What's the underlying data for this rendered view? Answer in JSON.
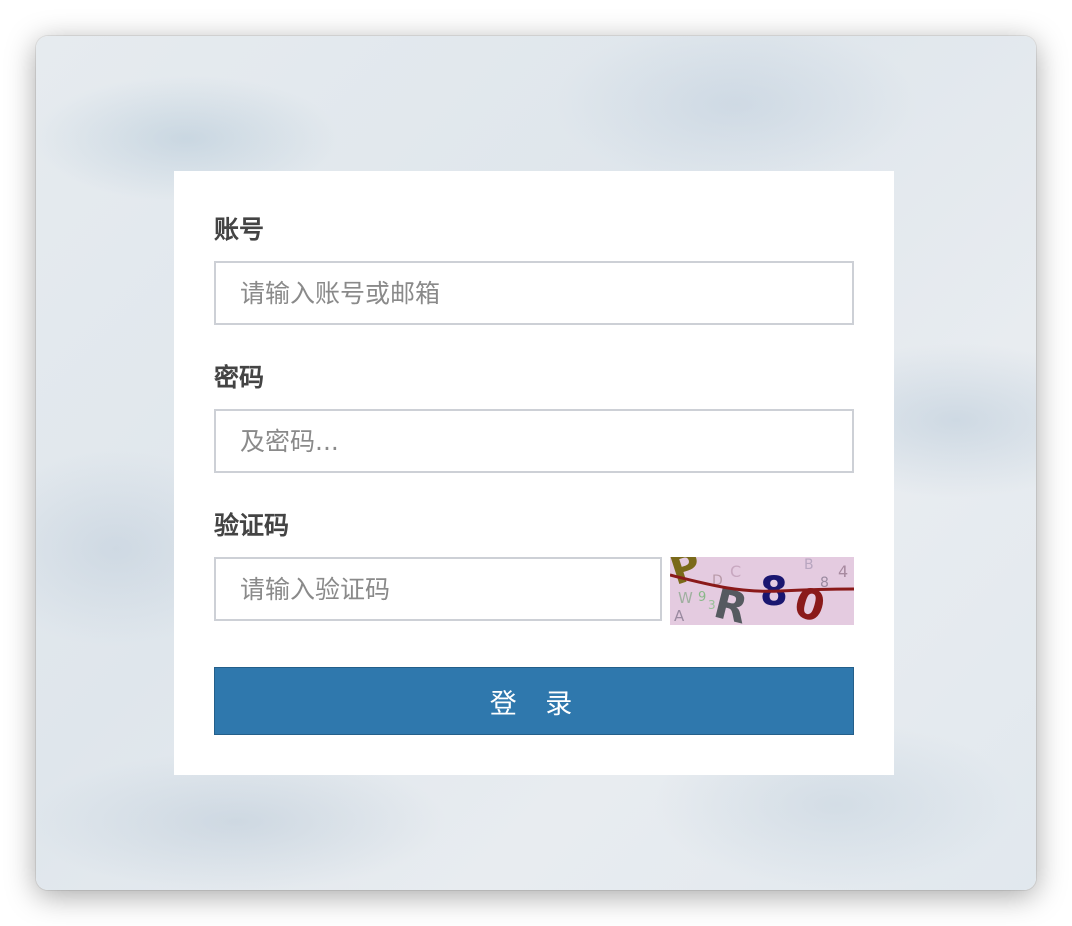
{
  "form": {
    "account": {
      "label": "账号",
      "placeholder": "请输入账号或邮箱"
    },
    "password": {
      "label": "密码",
      "placeholder": "及密码..."
    },
    "captcha": {
      "label": "验证码",
      "placeholder": "请输入验证码",
      "image_text": "PR80"
    },
    "submit_label": "登 录"
  },
  "colors": {
    "button": "#2f78ad",
    "captcha_bg": "#e4cbe0"
  }
}
